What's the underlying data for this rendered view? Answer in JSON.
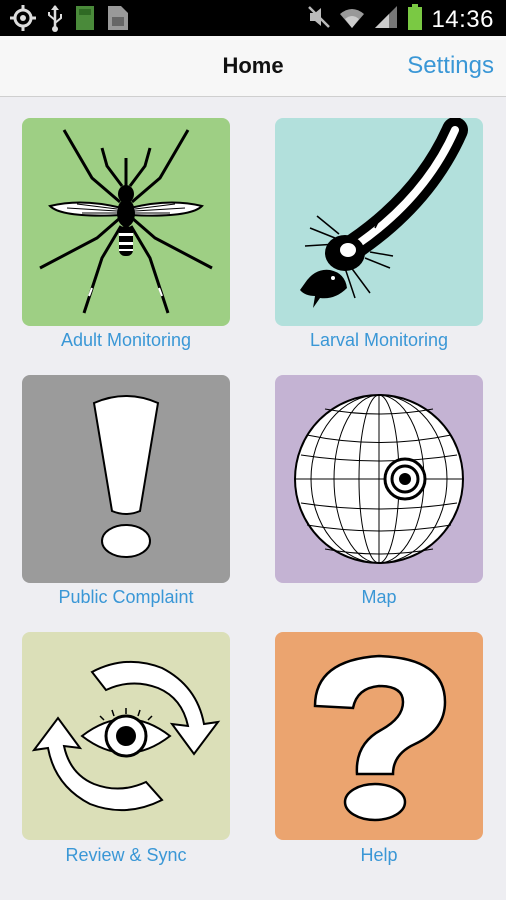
{
  "status_bar": {
    "time": "14:36",
    "icons": [
      "gps-icon",
      "usb-icon",
      "sd-card-icon",
      "sim-card-icon",
      "mute-icon",
      "wifi-icon",
      "signal-icon",
      "battery-icon"
    ]
  },
  "action_bar": {
    "title": "Home",
    "settings_label": "Settings"
  },
  "tiles": [
    {
      "label": "Adult Monitoring",
      "color": "#9ecf84",
      "icon": "mosquito-icon"
    },
    {
      "label": "Larval Monitoring",
      "color": "#b2e0dc",
      "icon": "larva-icon"
    },
    {
      "label": "Public Complaint",
      "color": "#9b9b9b",
      "icon": "exclamation-icon"
    },
    {
      "label": "Map",
      "color": "#c4b3d3",
      "icon": "globe-target-icon"
    },
    {
      "label": "Review & Sync",
      "color": "#dbdfb8",
      "icon": "eye-sync-icon"
    },
    {
      "label": "Help",
      "color": "#eba46f",
      "icon": "question-icon"
    }
  ],
  "colors": {
    "accent": "#3a97d6",
    "background": "#eeeef2"
  }
}
